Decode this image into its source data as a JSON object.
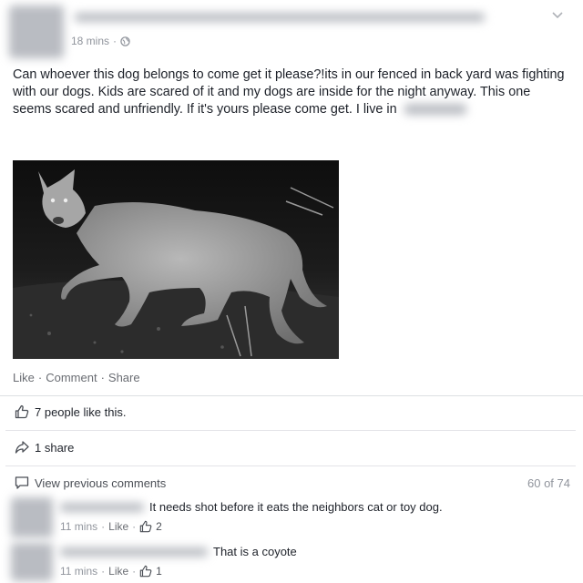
{
  "post": {
    "timestamp": "18 mins",
    "text": "Can whoever this dog belongs to come get it please?!its in our fenced in back yard was fighting with our dogs. Kids are scared of it and my dogs are inside for the night anyway. This one seems scared and unfriendly. If it's yours please come get. I live in",
    "photo_alt": "black and white night camera photo of a coyote walking",
    "actions": {
      "like": "Like",
      "comment": "Comment",
      "share": "Share",
      "separator": "·"
    }
  },
  "reactions": {
    "likes_text": "7 people like this.",
    "shares_text": "1 share"
  },
  "comments": {
    "view_previous": "View previous comments",
    "count": "60 of 74",
    "items": [
      {
        "text": "It needs shot before it eats the neighbors cat or toy dog.",
        "time": "11 mins",
        "like": "Like",
        "like_count": "2"
      },
      {
        "text": "That is a coyote",
        "time": "11 mins",
        "like": "Like",
        "like_count": "1"
      }
    ]
  },
  "icons": {
    "globe": "globe-icon",
    "chevron": "chevron-down-icon",
    "thumbs_up": "thumbs-up-icon",
    "share": "share-arrow-icon",
    "comment": "comment-bubble-icon"
  }
}
